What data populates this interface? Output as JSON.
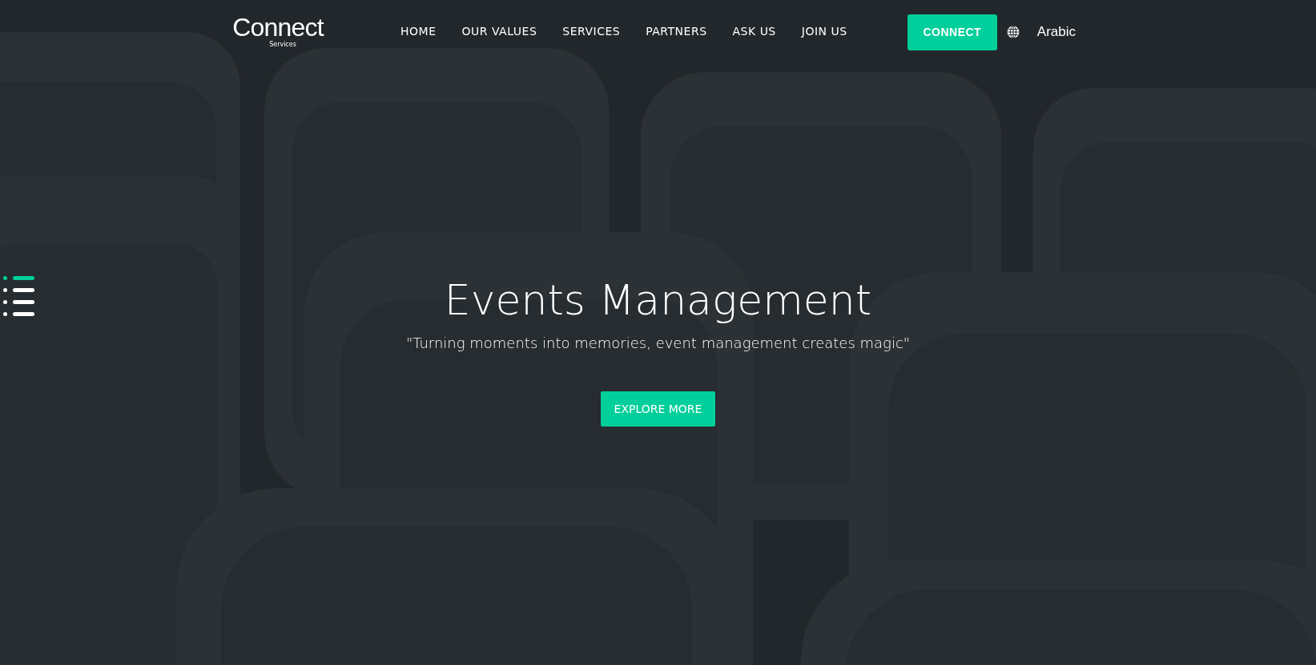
{
  "logo": {
    "name": "Connect",
    "tagline": "Services"
  },
  "nav": [
    {
      "label": "HOME"
    },
    {
      "label": "OUR VALUES"
    },
    {
      "label": "SERVICES"
    },
    {
      "label": "PARTNERS"
    },
    {
      "label": "ASK US"
    },
    {
      "label": "JOIN US"
    }
  ],
  "connect_button": "CONNECT",
  "language": "Arabic",
  "slides": [
    {
      "selected": true
    },
    {
      "selected": false
    },
    {
      "selected": false
    },
    {
      "selected": false
    }
  ],
  "hero": {
    "title": "Events Management",
    "subtitle": "\"Turning moments into memories, event management creates magic\"",
    "button": "EXPLORE MORE"
  }
}
